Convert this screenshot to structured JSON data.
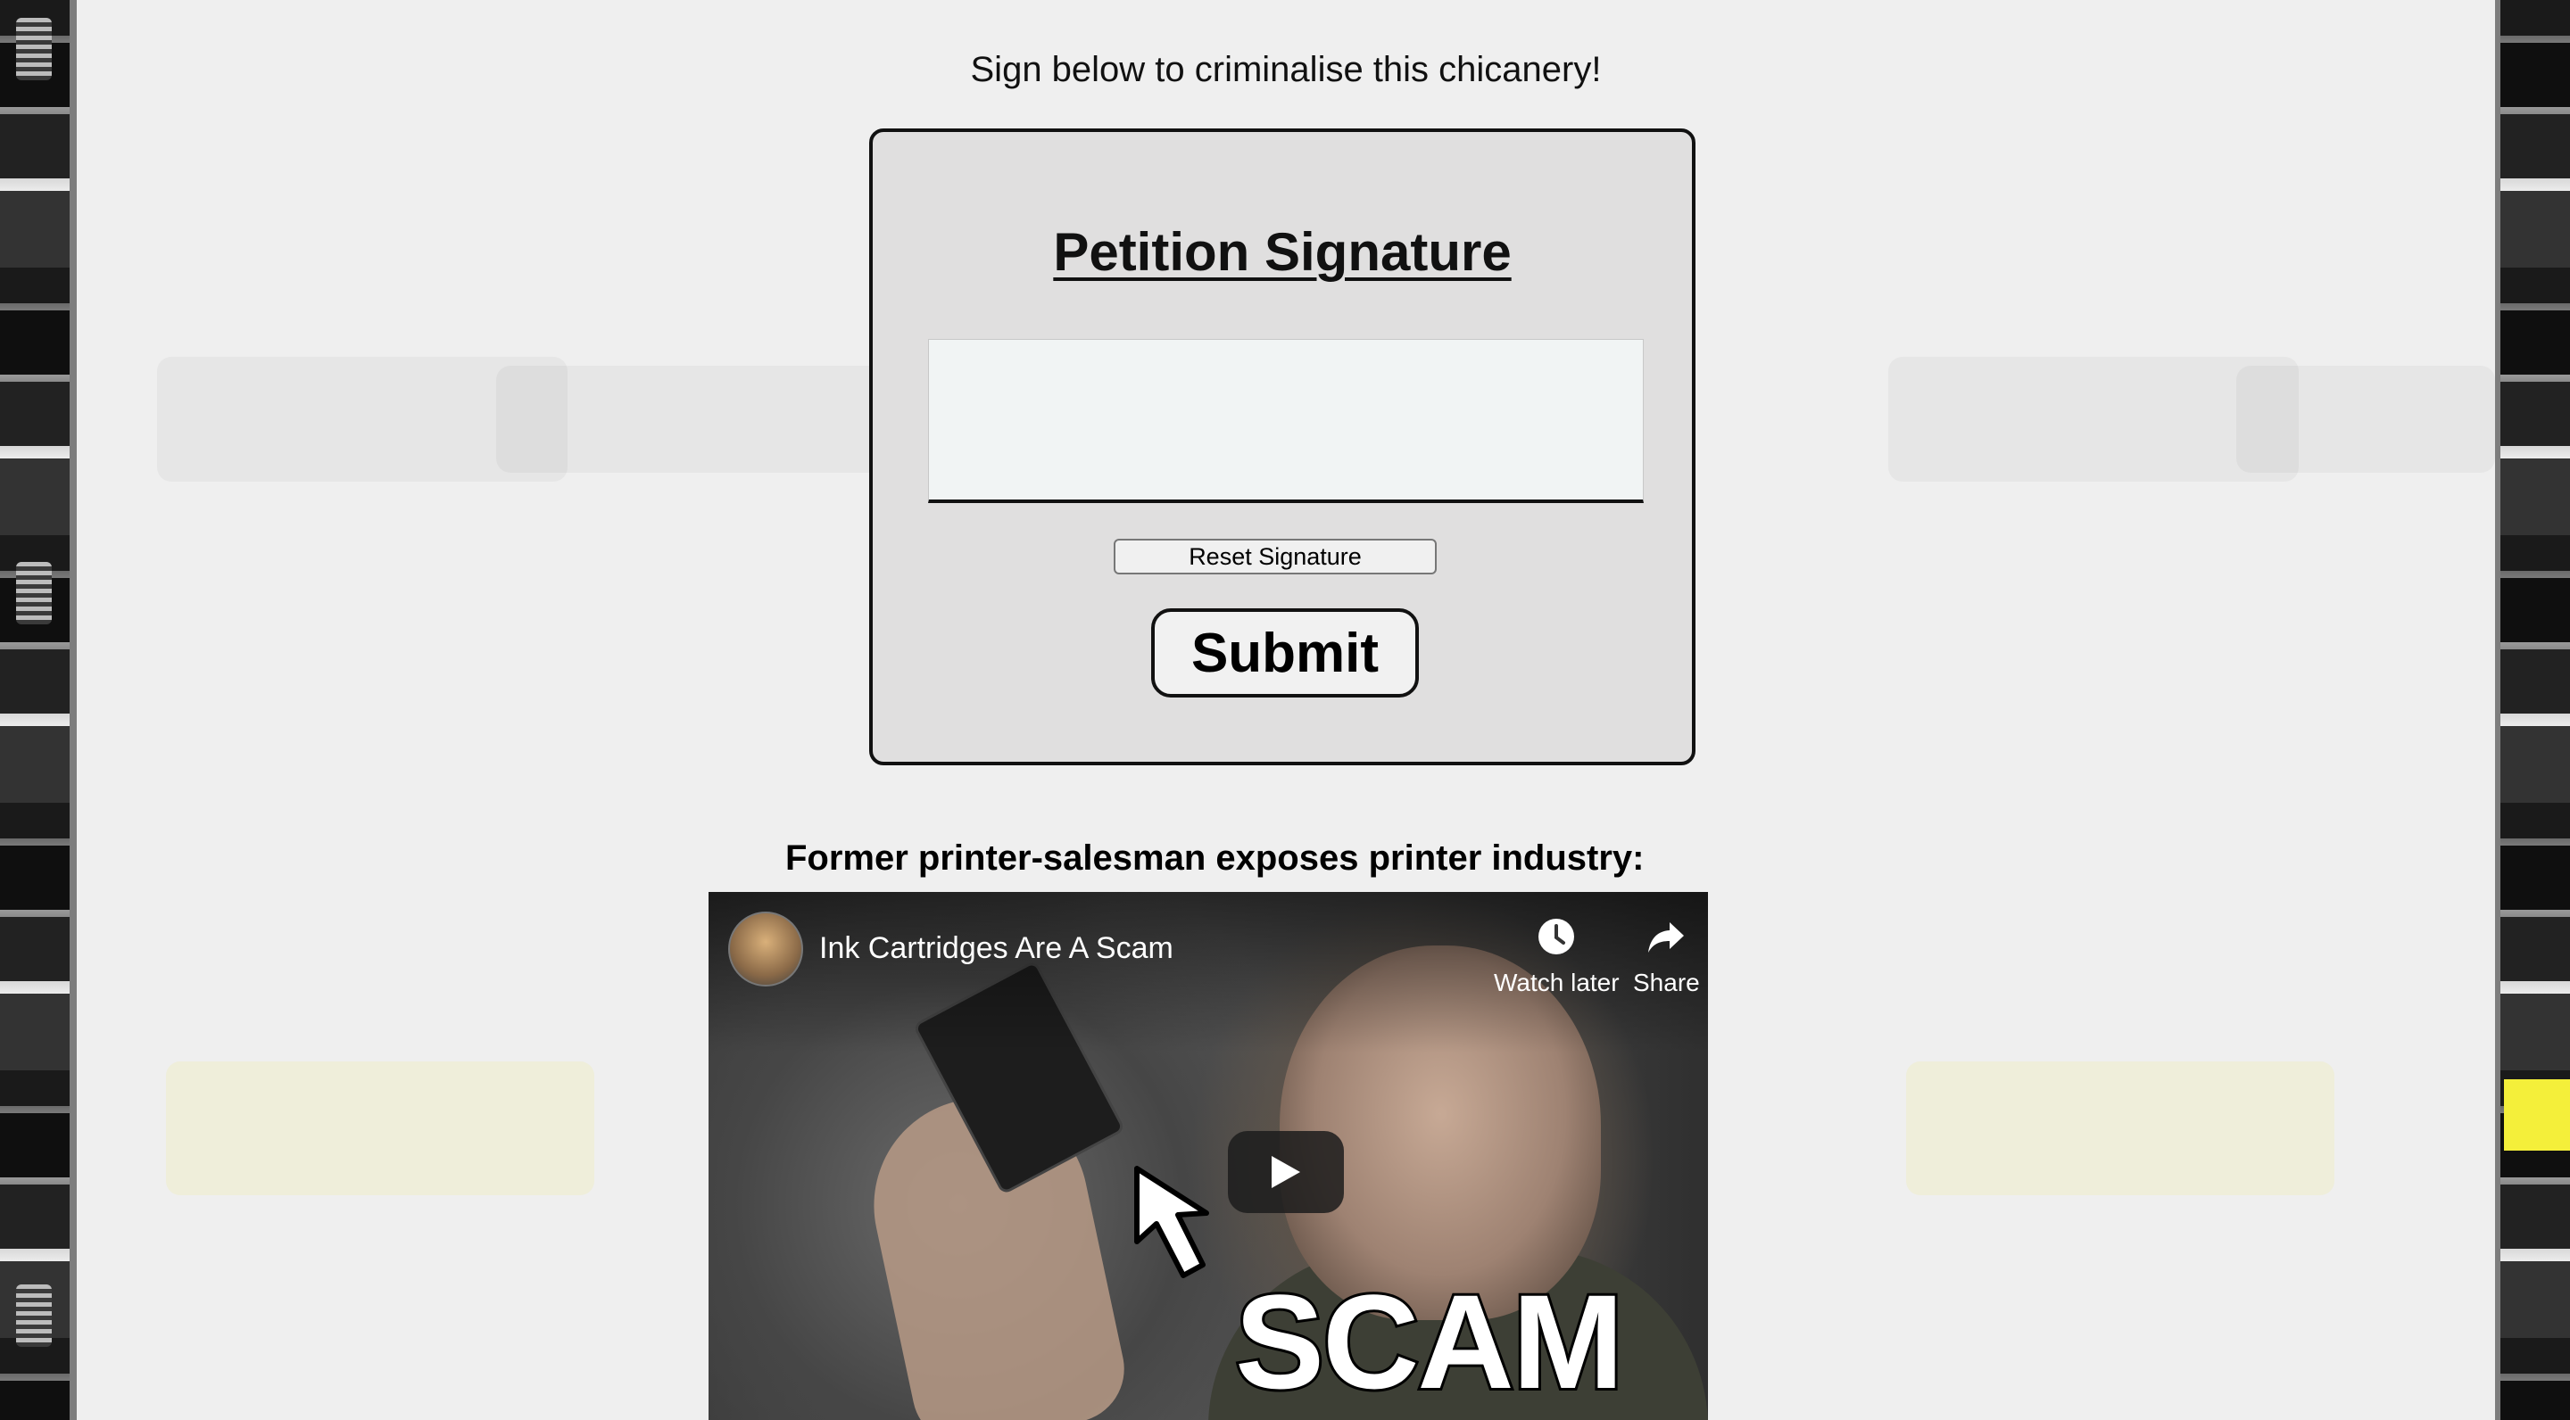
{
  "page": {
    "intro_text": "Sign below to criminalise this chicanery!"
  },
  "petition": {
    "title": "Petition Signature",
    "reset_label": "Reset Signature",
    "submit_label": "Submit"
  },
  "video_section": {
    "heading": "Former printer-salesman exposes printer industry:",
    "video": {
      "title": "Ink Cartridges Are A Scam",
      "watch_later_label": "Watch later",
      "share_label": "Share",
      "thumbnail_text": "SCAM"
    }
  },
  "colors": {
    "page_background": "#efefef",
    "petition_box_background": "#e0dfdf",
    "signature_pad_background": "#f1f4f4",
    "border": "#111111"
  },
  "icons": {
    "watch_later": "clock-icon",
    "share": "share-arrow-icon",
    "play": "play-icon",
    "thumbnail_pointer": "cursor-arrow-icon"
  }
}
